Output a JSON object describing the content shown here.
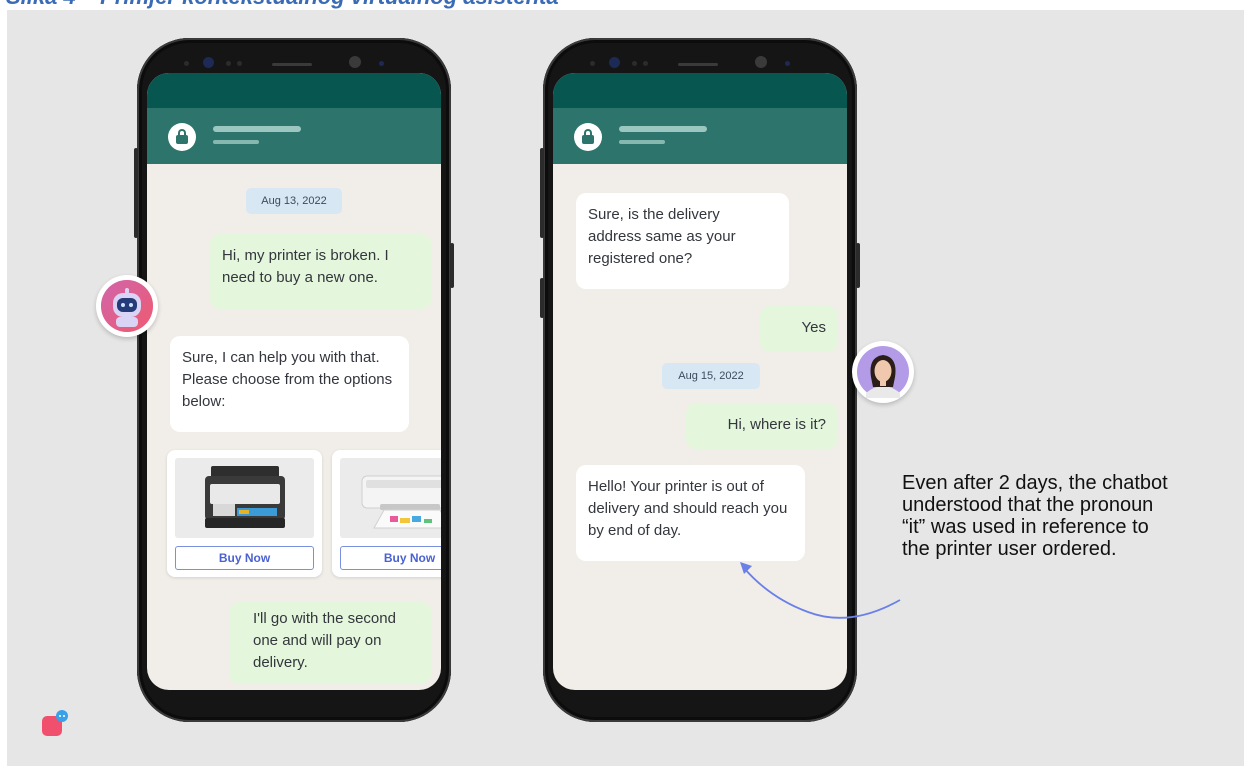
{
  "heading_text": "Slika 4 – Primjer kontekstualnog virtualnog asistenta",
  "phone1": {
    "date": "Aug 13, 2022",
    "messages": [
      {
        "side": "out",
        "text": "Hi, my printer is broken. I need to buy a new one."
      },
      {
        "side": "in",
        "text": "Sure, I can help you with that. Please choose from the options below:"
      },
      {
        "side": "out",
        "text": "I'll go with the second one and will pay on delivery."
      }
    ],
    "products": [
      {
        "icon": "printer-image",
        "button": "Buy Now"
      },
      {
        "icon": "printer-image",
        "button": "Buy Now"
      }
    ]
  },
  "phone2": {
    "messages": [
      {
        "side": "in",
        "text": "Sure, is the delivery address same as your registered one?"
      },
      {
        "side": "out",
        "text": "Yes"
      },
      {
        "side": "out",
        "text": "Hi, where is it?"
      },
      {
        "side": "in",
        "text": "Hello! Your printer is out of delivery and should reach you by end of day."
      }
    ],
    "date": "Aug 15, 2022"
  },
  "annotation": "Even after 2 days, the chatbot understood that the pronoun “it” was used in reference to the printer user ordered.",
  "icons": {
    "bot": "robot-avatar-icon",
    "user": "woman-avatar-icon",
    "logo": "chat-logo-icon",
    "header": "lock-icon"
  },
  "colors": {
    "header": "#2d756c",
    "topbar": "#075650",
    "bubble_in": "#ffffff",
    "bubble_out": "#e4f7dc",
    "screen_bg": "#f1ede8",
    "date_chip": "#d7e8f4",
    "accent": "#4a62d1",
    "heading": "#3b6bb5"
  }
}
